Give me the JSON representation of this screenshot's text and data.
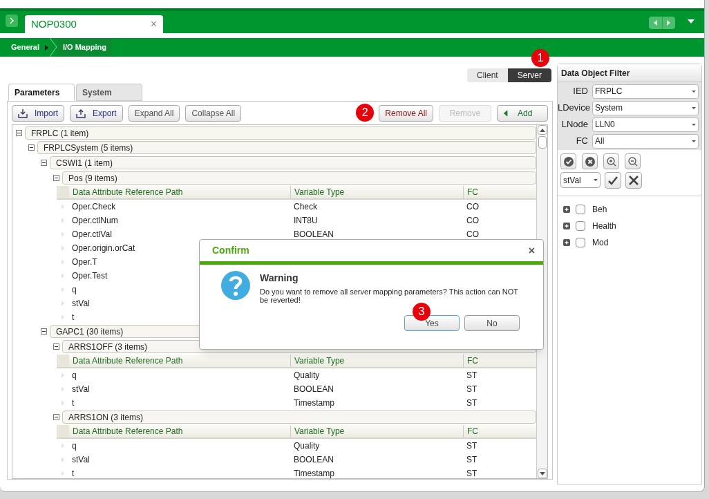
{
  "document_tab": {
    "title": "NOP0300",
    "close": "×"
  },
  "breadcrumb": [
    {
      "label": "General",
      "selected": false
    },
    {
      "label": "I/O Mapping",
      "selected": true
    }
  ],
  "mode_toggle": {
    "callout": "1",
    "options": [
      {
        "label": "Client",
        "selected": false
      },
      {
        "label": "Server",
        "selected": true
      }
    ]
  },
  "tabs": [
    {
      "label": "Parameters",
      "selected": true
    },
    {
      "label": "System",
      "selected": false
    }
  ],
  "toolbar": [
    {
      "label": "Import",
      "kind": "import",
      "disabled": false
    },
    {
      "label": "Export",
      "kind": "export",
      "disabled": false
    },
    {
      "label": "Expand All",
      "kind": "plain",
      "disabled": false
    },
    {
      "label": "Collapse All",
      "kind": "plain",
      "disabled": false
    },
    {
      "label": "Remove All",
      "kind": "danger",
      "disabled": false,
      "callout": "2"
    },
    {
      "label": "Remove",
      "kind": "plain",
      "disabled": true
    },
    {
      "label": "Add",
      "kind": "add",
      "disabled": false
    }
  ],
  "tree": [
    {
      "kind": "group",
      "label": "FRPLC (1 item)",
      "expanded": true,
      "children": [
        {
          "kind": "group",
          "label": "FRPLCSystem (5 items)",
          "expanded": true,
          "children": [
            {
              "kind": "group",
              "label": "CSWI1 (1 item)",
              "expanded": true,
              "children": [
                {
                  "kind": "group",
                  "label": "Pos (9 items)",
                  "expanded": true,
                  "children": [
                    {
                      "kind": "table",
                      "columns": [
                        "Data Attribute Reference Path",
                        "Variable Type",
                        "FC"
                      ],
                      "rows": [
                        {
                          "path": "Oper.Check",
                          "type": "Check",
                          "fc": "CO"
                        },
                        {
                          "path": "Oper.ctlNum",
                          "type": "INT8U",
                          "fc": "CO"
                        },
                        {
                          "path": "Oper.ctlVal",
                          "type": "BOOLEAN",
                          "fc": "CO"
                        },
                        {
                          "path": "Oper.origin.orCat"
                        },
                        {
                          "path": "Oper.T"
                        },
                        {
                          "path": "Oper.Test"
                        },
                        {
                          "path": "q"
                        },
                        {
                          "path": "stVal"
                        },
                        {
                          "path": "t"
                        }
                      ]
                    }
                  ]
                }
              ]
            },
            {
              "kind": "group",
              "label": "GAPC1 (30 items)",
              "expanded": true,
              "children": [
                {
                  "kind": "group",
                  "label": "ARRS1OFF (3 items)",
                  "expanded": true,
                  "children": [
                    {
                      "kind": "table",
                      "columns": [
                        "Data Attribute Reference Path",
                        "Variable Type",
                        "FC"
                      ],
                      "rows": [
                        {
                          "path": "q",
                          "type": "Quality",
                          "fc": "ST"
                        },
                        {
                          "path": "stVal",
                          "type": "BOOLEAN",
                          "fc": "ST"
                        },
                        {
                          "path": "t",
                          "type": "Timestamp",
                          "fc": "ST"
                        }
                      ]
                    }
                  ]
                },
                {
                  "kind": "group",
                  "label": "ARRS1ON (3 items)",
                  "expanded": true,
                  "children": [
                    {
                      "kind": "table",
                      "columns": [
                        "Data Attribute Reference Path",
                        "Variable Type",
                        "FC"
                      ],
                      "rows": [
                        {
                          "path": "q",
                          "type": "Quality",
                          "fc": "ST"
                        },
                        {
                          "path": "stVal",
                          "type": "BOOLEAN",
                          "fc": "ST"
                        },
                        {
                          "path": "t",
                          "type": "Timestamp",
                          "fc": "ST"
                        }
                      ]
                    }
                  ]
                }
              ]
            }
          ]
        }
      ]
    }
  ],
  "filter": {
    "title": "Data Object Filter",
    "fields": [
      {
        "label": "IED",
        "value": "FRPLC"
      },
      {
        "label": "LDevice",
        "value": "System"
      },
      {
        "label": "LNode",
        "value": "LLN0"
      },
      {
        "label": "FC",
        "value": "All"
      }
    ],
    "attribute_select": "stVal",
    "items": [
      {
        "label": "Beh",
        "expanded": false,
        "checked": false
      },
      {
        "label": "Health",
        "expanded": false,
        "checked": false
      },
      {
        "label": "Mod",
        "expanded": false,
        "checked": false
      }
    ]
  },
  "dialog": {
    "title": "Confirm",
    "close": "×",
    "heading": "Warning",
    "message": "Do you want to remove all server mapping parameters? This action can NOT be reverted!",
    "buttons": [
      {
        "label": "Yes",
        "focused": true,
        "callout": "3"
      },
      {
        "label": "No",
        "focused": false
      }
    ]
  }
}
